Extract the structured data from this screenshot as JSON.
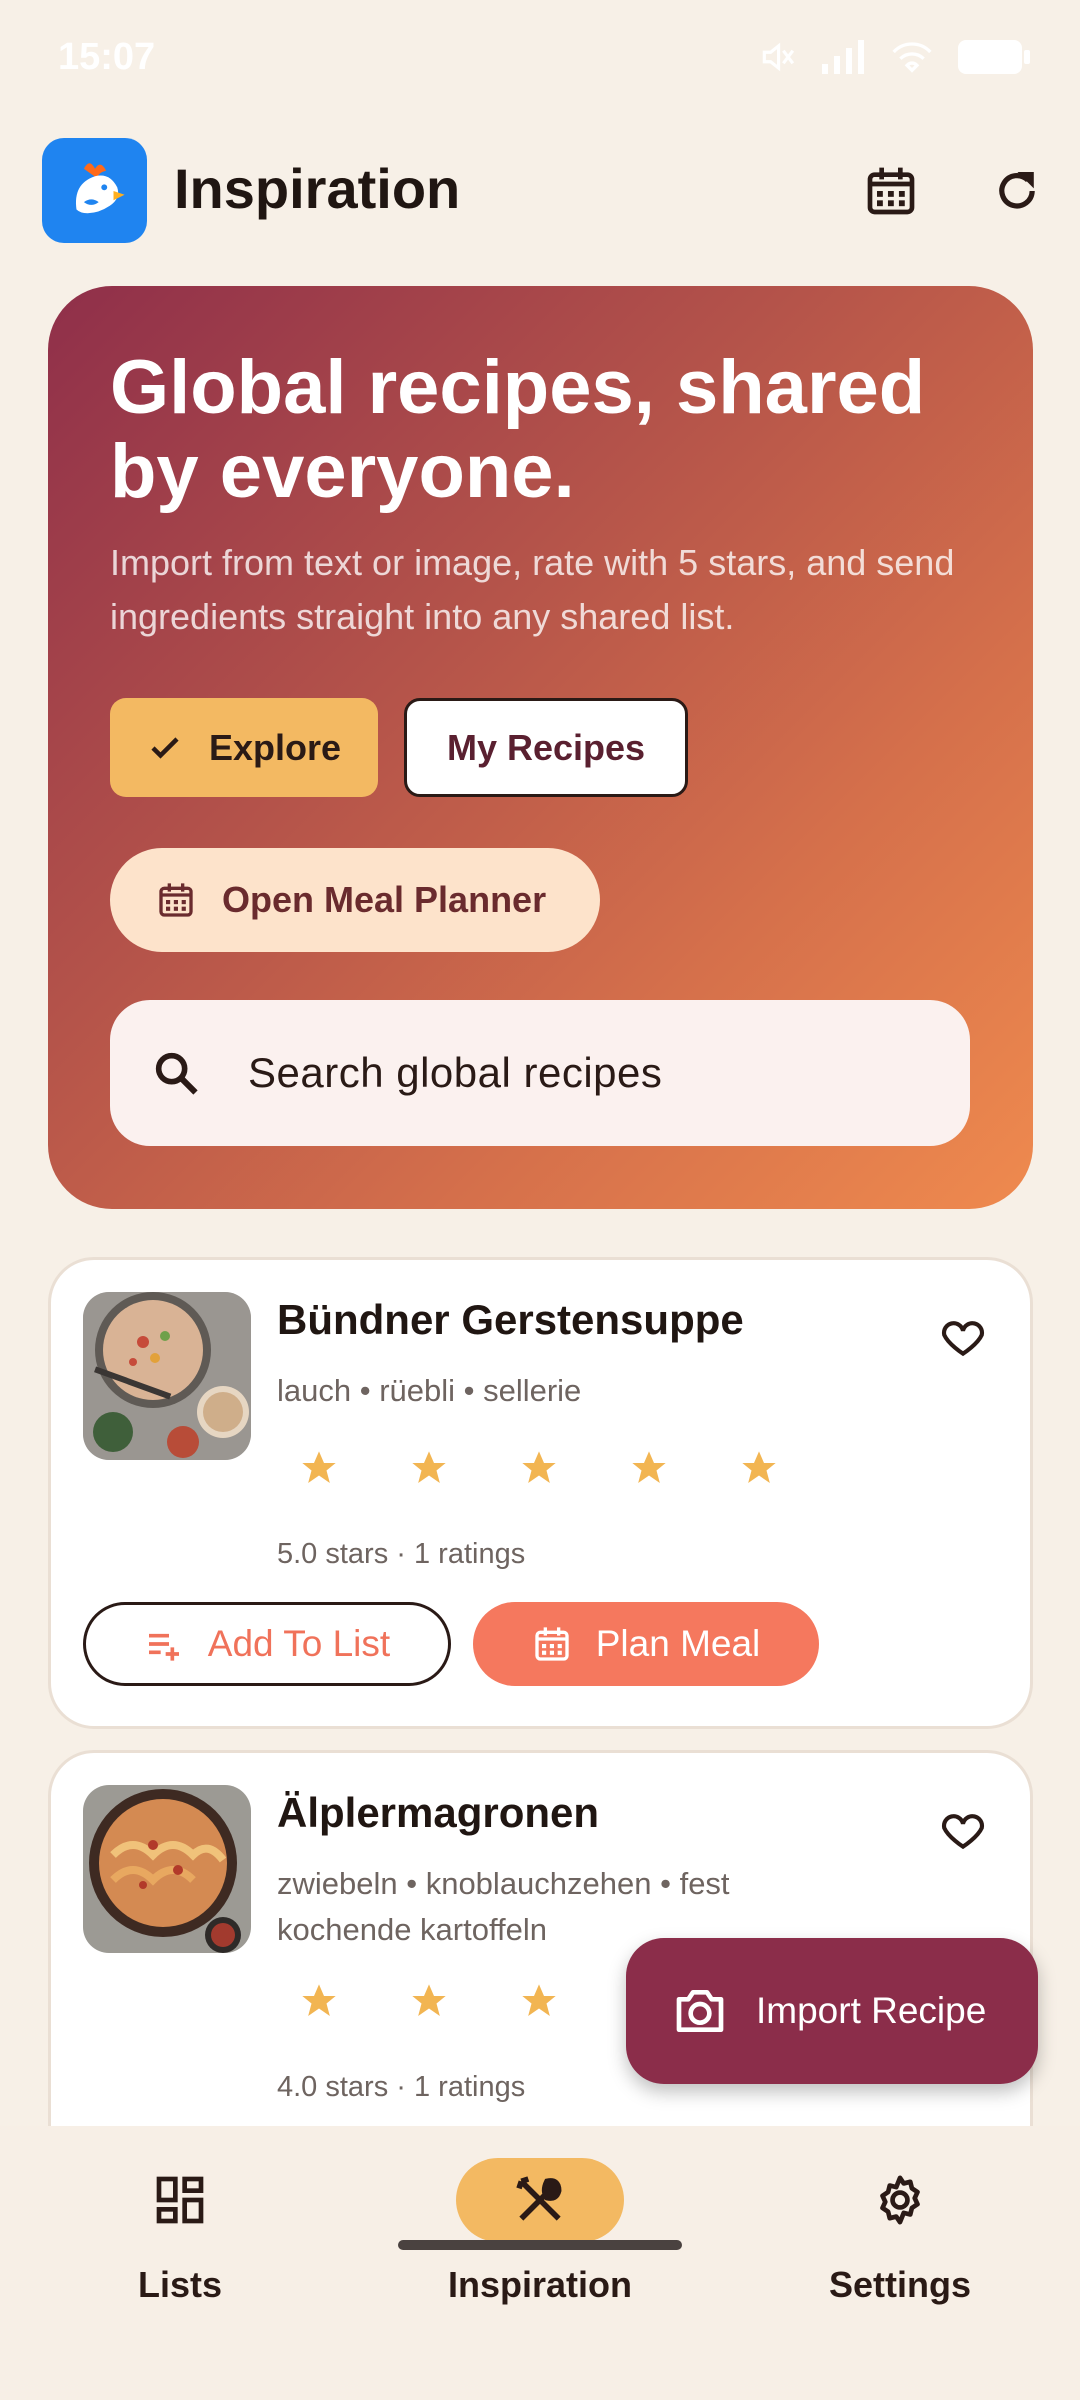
{
  "status_bar": {
    "time": "15:07"
  },
  "app_bar": {
    "title": "Inspiration",
    "icons": [
      "calendar-icon",
      "refresh-icon"
    ]
  },
  "hero": {
    "title": "Global recipes, shared by everyone.",
    "subtitle": "Import from text or image, rate with 5 stars, and send ingredients straight into any shared list.",
    "segments": {
      "explore": "Explore",
      "my_recipes": "My Recipes",
      "selected": "Explore"
    },
    "planner_label": "Open Meal Planner",
    "search_placeholder": "Search global recipes"
  },
  "recipes": [
    {
      "title": "Bündner Gerstensuppe",
      "ingredients": "lauch • rüebli • sellerie",
      "stars": 5,
      "rating_text": "5.0 stars · 1 ratings",
      "add_label": "Add To List",
      "plan_label": "Plan Meal"
    },
    {
      "title": "Älplermagronen",
      "ingredients": "zwiebeln • knoblauchzehen • fest kochende kartoffeln",
      "stars": 4,
      "rating_text": "4.0 stars · 1 ratings"
    }
  ],
  "fab": {
    "label": "Import Recipe"
  },
  "nav": {
    "lists": "Lists",
    "inspiration": "Inspiration",
    "settings": "Settings",
    "active": "Inspiration"
  },
  "colors": {
    "accent": "#f3b962",
    "primary": "#8b2d4a",
    "coral": "#f5785e",
    "background": "#f7f0e7"
  }
}
